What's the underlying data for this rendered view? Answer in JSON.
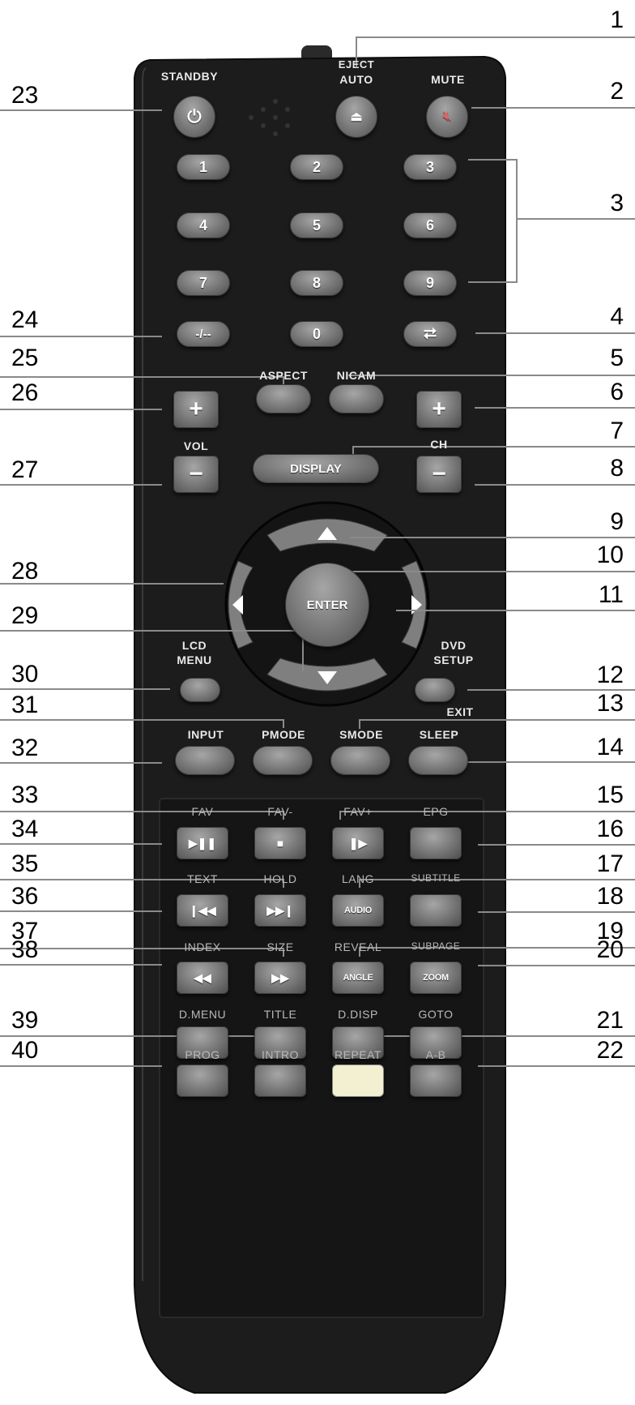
{
  "callouts_left": [
    "23",
    "24",
    "25",
    "26",
    "27",
    "28",
    "29",
    "30",
    "31",
    "32",
    "33",
    "34",
    "35",
    "36",
    "37",
    "38",
    "39",
    "40"
  ],
  "callouts_right": [
    "1",
    "2",
    "3",
    "4",
    "5",
    "6",
    "7",
    "8",
    "9",
    "10",
    "11",
    "12",
    "13",
    "14",
    "15",
    "16",
    "17",
    "18",
    "19",
    "20",
    "21",
    "22"
  ],
  "labels": {
    "standby": "STANDBY",
    "eject": "EJECT",
    "auto": "AUTO",
    "mute": "MUTE",
    "aspect": "ASPECT",
    "nicam": "NICAM",
    "vol": "VOL",
    "ch": "CH",
    "lcd_menu_1": "LCD",
    "lcd_menu_2": "MENU",
    "dvd_setup_1": "DVD",
    "dvd_setup_2": "SETUP",
    "exit": "EXIT",
    "input": "INPUT",
    "pmode": "PMODE",
    "smode": "SMODE",
    "sleep": "SLEEP",
    "fav": "FAV",
    "fav_minus": "FAV-",
    "fav_plus": "FAV+",
    "epg": "EPG",
    "text": "TEXT",
    "hold": "HOLD",
    "lang": "LANG",
    "subtitle": "SUBTITLE",
    "index": "INDEX",
    "size": "SIZE",
    "reveal": "REVEAL",
    "subpage": "SUBPAGE",
    "d_menu": "D.MENU",
    "title": "TITLE",
    "d_disp": "D.DISP",
    "goto": "GOTO",
    "prog": "PROG",
    "intro": "INTRO",
    "repeat": "REPEAT",
    "a_b": "A-B"
  },
  "buttons": {
    "n1": "1",
    "n2": "2",
    "n3": "3",
    "n4": "4",
    "n5": "5",
    "n6": "6",
    "n7": "7",
    "n8": "8",
    "n9": "9",
    "n0": "0",
    "dash": "-/--",
    "plus": "+",
    "minus": "−",
    "display": "DISPLAY",
    "enter": "ENTER",
    "audio": "AUDIO",
    "angle": "ANGLE",
    "zoom": "ZOOM"
  },
  "colors": {
    "body": "#1e1e1e",
    "button": "#7a7a7a",
    "repeat_button": "#f3f0d2",
    "leader_line": "#8a8a8a"
  }
}
